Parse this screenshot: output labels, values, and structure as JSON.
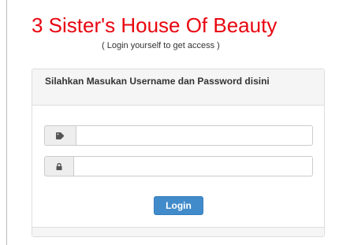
{
  "page": {
    "title": "3 Sister's House Of Beauty",
    "subtitle": "( Login yourself to get access )"
  },
  "panel": {
    "heading": "Silahkan Masukan Username dan Password disini"
  },
  "form": {
    "username": {
      "icon": "tag-icon",
      "value": "",
      "placeholder": ""
    },
    "password": {
      "icon": "lock-icon",
      "value": "",
      "placeholder": ""
    },
    "login_label": "Login"
  },
  "colors": {
    "title": "#e8050f",
    "button": "#428bca",
    "panel_heading_bg": "#f5f5f5",
    "addon_bg": "#eeeeee"
  }
}
